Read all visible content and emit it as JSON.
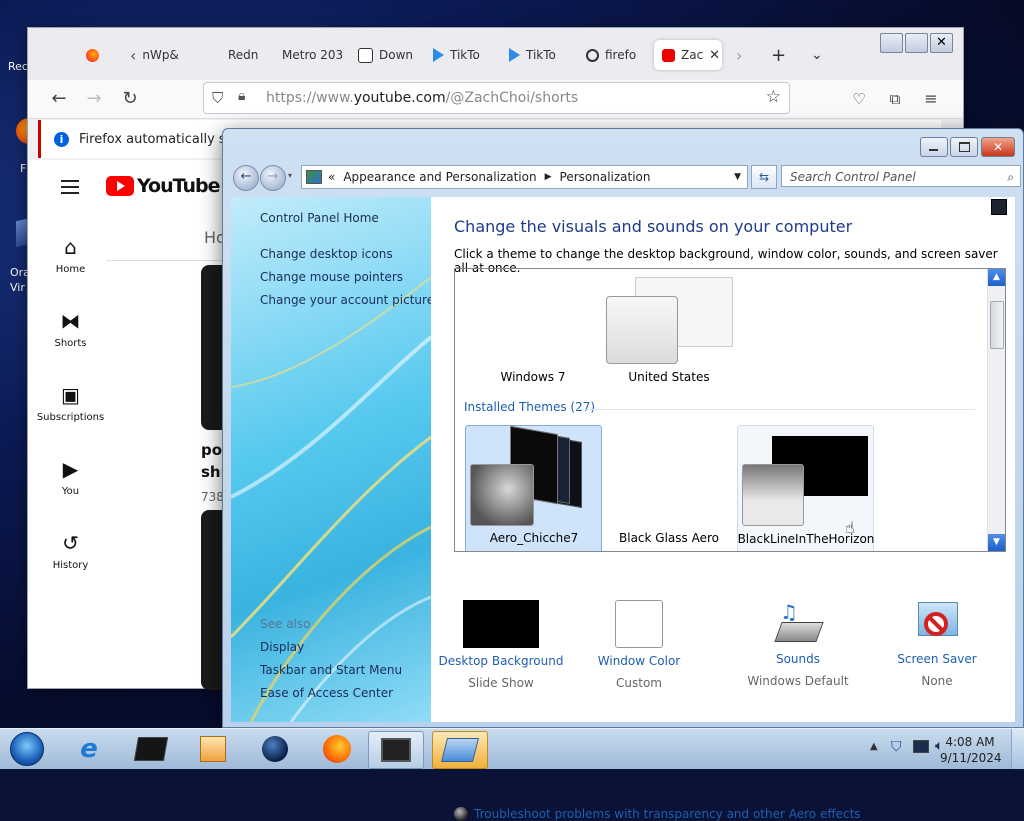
{
  "desktop": {
    "icons": [
      {
        "label": "Rec"
      },
      {
        "label": "F"
      },
      {
        "label": "Ora\nVir"
      }
    ]
  },
  "firefox": {
    "tabs": [
      {
        "label": "",
        "icon": "firefox-icon"
      },
      {
        "label": "nWp&",
        "icon": "back-tab-icon"
      },
      {
        "label": "Redn",
        "icon": "page-icon"
      },
      {
        "label": "Metro 203",
        "icon": "page-icon"
      },
      {
        "label": "Down",
        "icon": "download-icon"
      },
      {
        "label": "TikTo",
        "icon": "play-store-icon"
      },
      {
        "label": "TikTo",
        "icon": "play-store-icon"
      },
      {
        "label": "firefo",
        "icon": "github-icon"
      },
      {
        "label": "Zac",
        "icon": "youtube-icon"
      }
    ],
    "url_scheme": "https://www.",
    "url_host": "youtube.com",
    "url_path": "/@ZachChoi/shorts",
    "notification": "Firefox automatically sends",
    "youtube": {
      "logo_text": "YouTube",
      "nav": [
        {
          "label": "Home"
        },
        {
          "label": "Shorts"
        },
        {
          "label": "Subscriptions"
        },
        {
          "label": "You"
        },
        {
          "label": "History"
        }
      ],
      "tab_fragment": "Ho",
      "video_title_fragment_1": "pop",
      "video_title_fragment_2": "shr",
      "views_fragment": "738"
    }
  },
  "control_panel": {
    "breadcrumb": [
      "Appearance and Personalization",
      "Personalization"
    ],
    "search_placeholder": "Search Control Panel",
    "left_links": [
      "Control Panel Home",
      "Change desktop icons",
      "Change mouse pointers",
      "Change your account picture"
    ],
    "see_also_label": "See also",
    "see_also_links": [
      "Display",
      "Taskbar and Start Menu",
      "Ease of Access Center"
    ],
    "title": "Change the visuals and sounds on your computer",
    "subtitle": "Click a theme to change the desktop background, window color, sounds, and screen saver all at once.",
    "my_themes": [
      {
        "label": "Windows 7"
      },
      {
        "label": "United States"
      }
    ],
    "installed_group": "Installed Themes (27)",
    "installed_themes": [
      {
        "label": "Aero_Chicche7"
      },
      {
        "label": "Black Glass Aero"
      },
      {
        "label": "BlackLineInTheHorizon"
      }
    ],
    "bottom": [
      {
        "link": "Desktop Background",
        "value": "Slide Show"
      },
      {
        "link": "Window Color",
        "value": "Custom"
      },
      {
        "link": "Sounds",
        "value": "Windows Default"
      },
      {
        "link": "Screen Saver",
        "value": "None"
      }
    ],
    "troubleshoot": "Troubleshoot problems with transparency and other Aero effects"
  },
  "taskbar": {
    "time": "4:08 AM",
    "date": "9/11/2024"
  }
}
